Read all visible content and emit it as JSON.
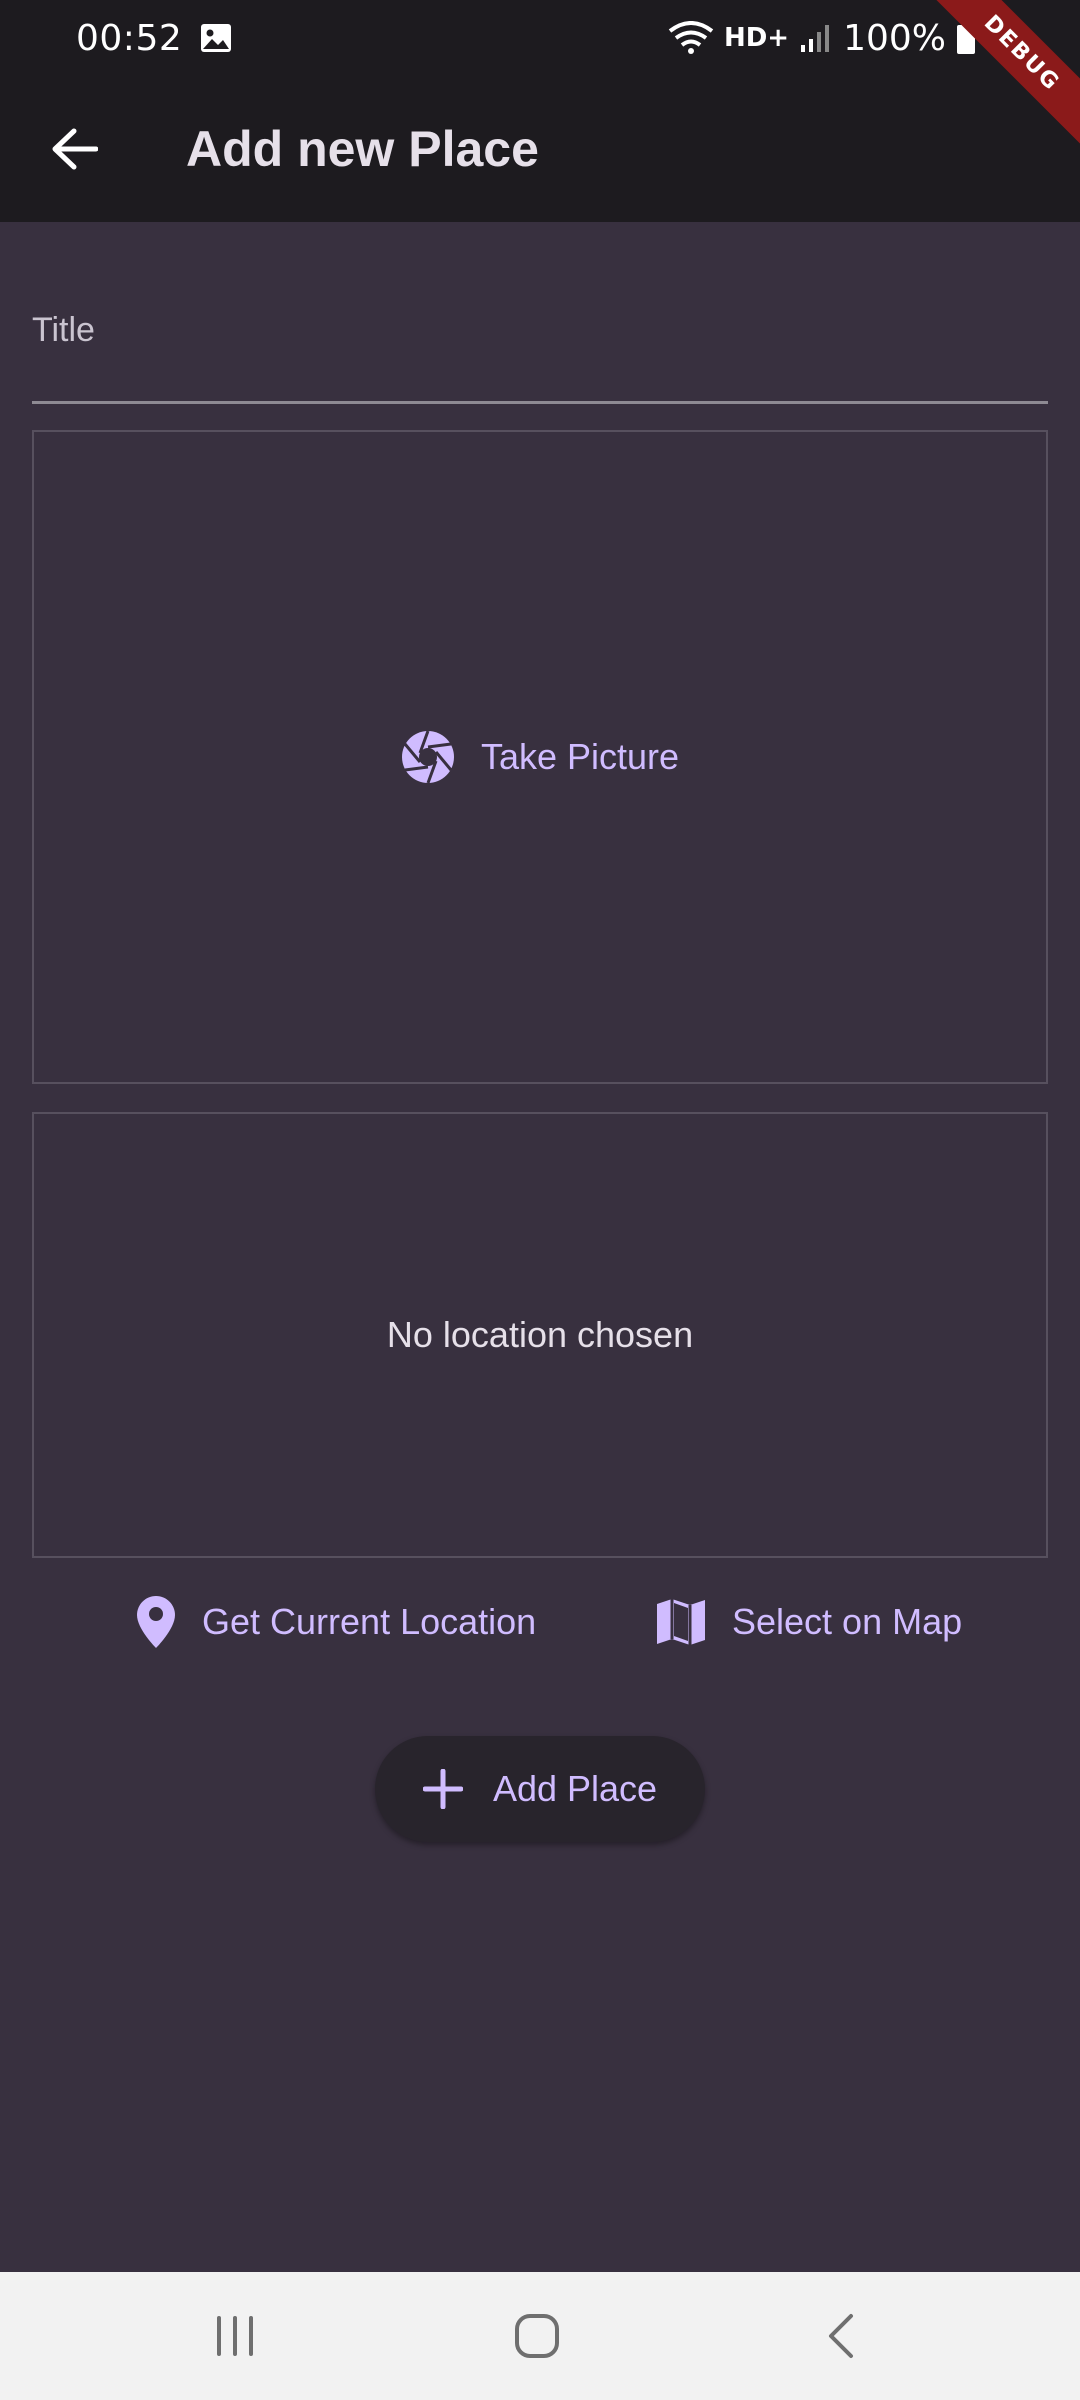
{
  "status_bar": {
    "time": "00:52",
    "network": "HD+",
    "battery": "100%"
  },
  "debug_banner": "DEBUG",
  "app_bar": {
    "title": "Add new Place",
    "back_icon": "arrow-back-icon"
  },
  "form": {
    "title_placeholder": "Title",
    "title_value": ""
  },
  "image_input": {
    "button_label": "Take Picture",
    "icon": "camera-aperture-icon"
  },
  "location_input": {
    "empty_text": "No location chosen",
    "current_label": "Get Current Location",
    "map_label": "Select on Map"
  },
  "submit": {
    "label": "Add Place",
    "icon": "plus-icon"
  },
  "colors": {
    "accent": "#d0bcff",
    "background": "#38303f",
    "app_bar": "#1d1b1f"
  }
}
